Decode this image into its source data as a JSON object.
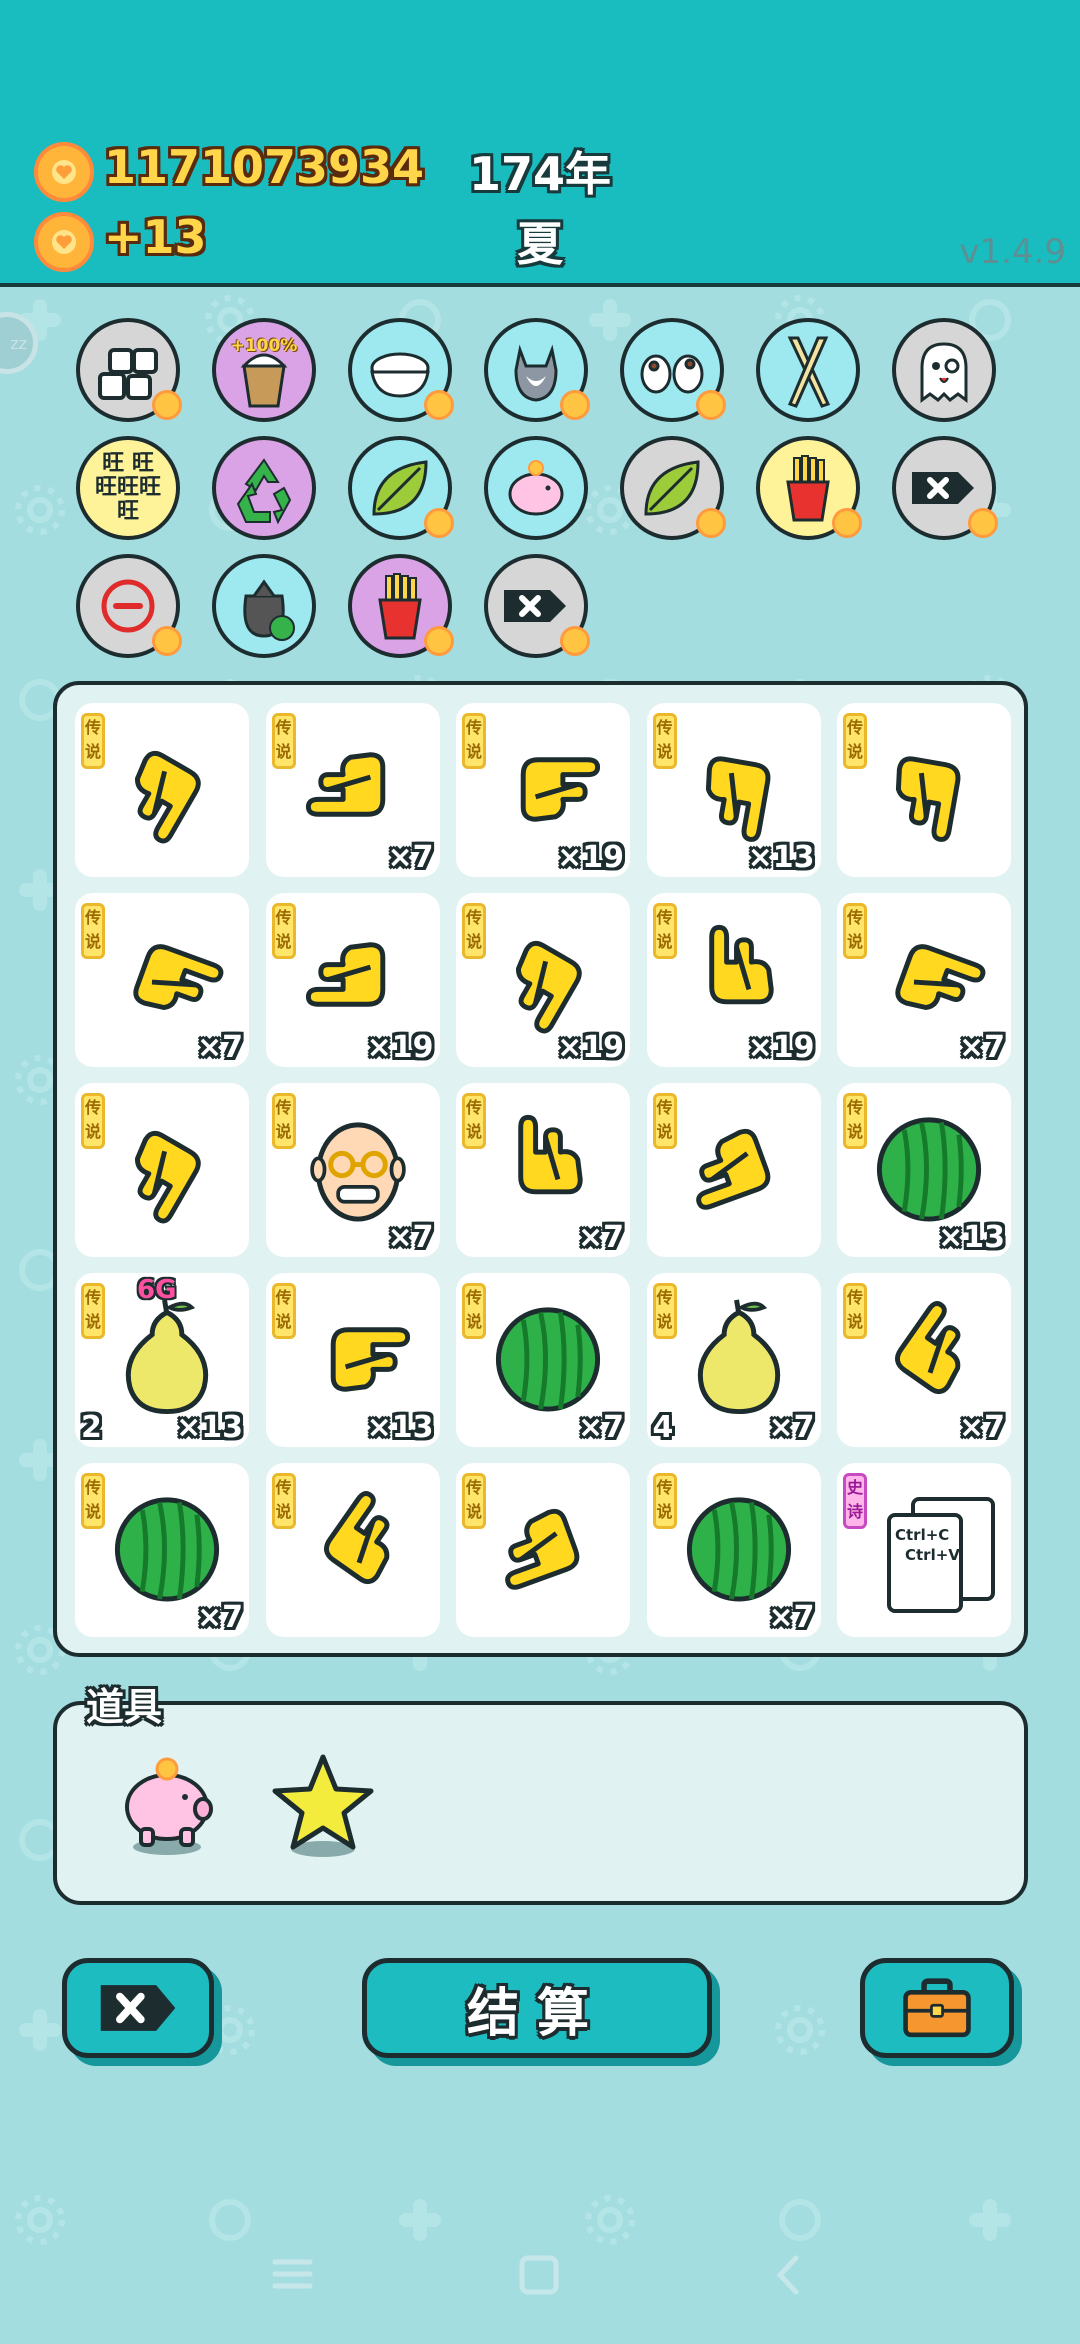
{
  "status": {
    "coins": "1171073934",
    "coins_per_spin": "+13",
    "year": "174年",
    "season": "夏",
    "version": "v1.4.9"
  },
  "sleep_label": "zz",
  "symbols_strip": [
    {
      "icon": "ice-cubes-icon",
      "bg": "#d6d6d6",
      "badge": true
    },
    {
      "icon": "bubble-tea-icon",
      "bg": "#d9a3e6",
      "badge": false,
      "text": "+100%"
    },
    {
      "icon": "rice-bowl-icon",
      "bg": "#9ee8f0",
      "badge": true
    },
    {
      "icon": "husky-dog-icon",
      "bg": "#9ee8f0",
      "badge": true
    },
    {
      "icon": "milk-cows-icon",
      "bg": "#9ee8f0",
      "badge": true
    },
    {
      "icon": "chopsticks-icon",
      "bg": "#9ee8f0",
      "badge": false
    },
    {
      "icon": "ghost-icon",
      "bg": "#d6d6d6",
      "badge": false
    },
    {
      "icon": "wang-text-icon",
      "bg": "#fff39a",
      "badge": false,
      "text": "旺"
    },
    {
      "icon": "recycle-icon",
      "bg": "#d9a3e6",
      "badge": false
    },
    {
      "icon": "leaf-icon",
      "bg": "#9ee8f0",
      "badge": true
    },
    {
      "icon": "piggy-bank-icon",
      "bg": "#9ee8f0",
      "badge": false
    },
    {
      "icon": "leaf-icon",
      "bg": "#d6d6d6",
      "badge": true
    },
    {
      "icon": "fries-icon",
      "bg": "#fff39a",
      "badge": true
    },
    {
      "icon": "remove-symbol-icon",
      "bg": "#d6d6d6",
      "badge": true
    },
    {
      "icon": "minus-circle-icon",
      "bg": "#d6d6d6",
      "badge": true
    },
    {
      "icon": "trash-bag-recycle-icon",
      "bg": "#9ee8f0",
      "badge": false
    },
    {
      "icon": "fries-icon",
      "bg": "#d9a3e6",
      "badge": true
    },
    {
      "icon": "remove-symbol-icon",
      "bg": "#d6d6d6",
      "badge": true
    }
  ],
  "board": {
    "cells": [
      {
        "rarity": "传说",
        "icon": "hand-point-down-left",
        "count": ""
      },
      {
        "rarity": "传说",
        "icon": "hand-point-left",
        "count": "×7"
      },
      {
        "rarity": "传说",
        "icon": "hand-point-right",
        "count": "×19"
      },
      {
        "rarity": "传说",
        "icon": "hand-point-down",
        "count": "×13"
      },
      {
        "rarity": "传说",
        "icon": "hand-point-down",
        "count": ""
      },
      {
        "rarity": "传说",
        "icon": "hand-point-right-down",
        "count": "×7"
      },
      {
        "rarity": "传说",
        "icon": "hand-point-left",
        "count": "×19"
      },
      {
        "rarity": "传说",
        "icon": "hand-point-down-left",
        "count": "×19"
      },
      {
        "rarity": "传说",
        "icon": "hand-point-up",
        "count": "×19"
      },
      {
        "rarity": "传说",
        "icon": "hand-point-right-down",
        "count": "×7"
      },
      {
        "rarity": "传说",
        "icon": "hand-point-down-left",
        "count": ""
      },
      {
        "rarity": "传说",
        "icon": "grandpa-face",
        "count": "×7"
      },
      {
        "rarity": "传说",
        "icon": "hand-point-up",
        "count": "×7"
      },
      {
        "rarity": "传说",
        "icon": "hand-point-left-down",
        "count": ""
      },
      {
        "rarity": "传说",
        "icon": "watermelon",
        "count": "×13"
      },
      {
        "rarity": "传说",
        "icon": "pear",
        "count": "×13",
        "num": "2",
        "tag": "6G"
      },
      {
        "rarity": "传说",
        "icon": "hand-point-right",
        "count": "×13"
      },
      {
        "rarity": "传说",
        "icon": "watermelon",
        "count": "×7"
      },
      {
        "rarity": "传说",
        "icon": "pear",
        "count": "×7",
        "num": "4"
      },
      {
        "rarity": "传说",
        "icon": "hand-point-up-right",
        "count": "×7"
      },
      {
        "rarity": "传说",
        "icon": "watermelon",
        "count": "×7"
      },
      {
        "rarity": "传说",
        "icon": "hand-point-up-right",
        "count": ""
      },
      {
        "rarity": "传说",
        "icon": "hand-point-left-down",
        "count": ""
      },
      {
        "rarity": "传说",
        "icon": "watermelon",
        "count": "×7"
      },
      {
        "rarity": "史诗",
        "icon": "copy-paste-card",
        "count": "",
        "card_top": "Ctrl+C",
        "card_bottom": "Ctrl+V"
      }
    ]
  },
  "tools": {
    "label": "道具",
    "items": [
      {
        "icon": "piggy-bank-icon"
      },
      {
        "icon": "star-icon"
      }
    ]
  },
  "buttons": {
    "remove_icon": "remove-symbol-icon",
    "settle_label": "结算",
    "bag_icon": "briefcase-icon"
  },
  "colors": {
    "header_bg": "#19bcbf",
    "page_bg": "#a4dde0",
    "coin_text": "#ffd54a",
    "legend_tag": "#ffe66b",
    "epic_tag": "#ffb4ea",
    "hand_yellow": "#ffd81f"
  }
}
